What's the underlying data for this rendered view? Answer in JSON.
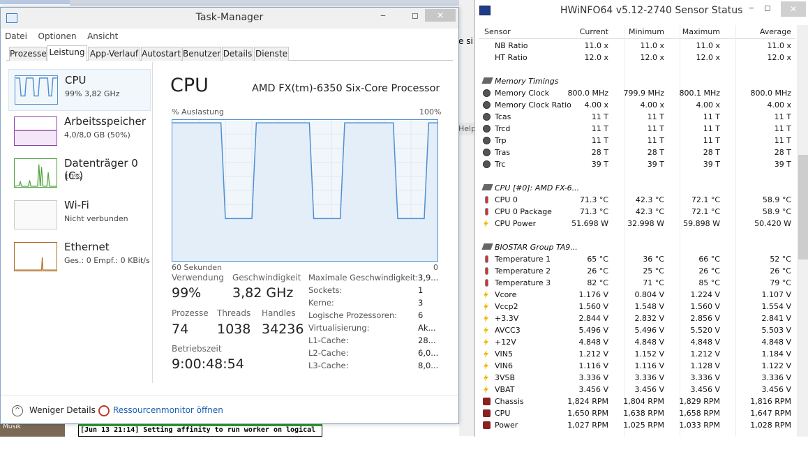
{
  "background": {
    "left_thumb_label": "Musik",
    "console_text": "[Jun 13 21:14] Setting affinity to run worker on logical",
    "edge_text": "e si",
    "edge_help": "Help"
  },
  "taskmanager": {
    "title": "Task-Manager",
    "window_buttons": [
      "‒",
      "◻",
      "✕"
    ],
    "menu": [
      "Datei",
      "Optionen",
      "Ansicht"
    ],
    "tabs": [
      "Prozesse",
      "Leistung",
      "App-Verlauf",
      "Autostart",
      "Benutzer",
      "Details",
      "Dienste"
    ],
    "active_tab": "Leistung",
    "sidebar": [
      {
        "name": "CPU",
        "sub": "99% 3,82 GHz"
      },
      {
        "name": "Arbeitsspeicher",
        "sub": "4,0/8,0 GB (50%)"
      },
      {
        "name": "Datenträger 0 (C:)",
        "sub": "10%"
      },
      {
        "name": "Wi-Fi",
        "sub": "Nicht verbunden"
      },
      {
        "name": "Ethernet",
        "sub": "Ges.: 0 Empf.: 0 KBit/s"
      }
    ],
    "cpu_title": "CPU",
    "cpu_model": "AMD FX(tm)-6350 Six-Core Processor",
    "util_label": "% Auslastung",
    "max_label": "100%",
    "time_label": "60 Sekunden",
    "zero_label": "0",
    "stats": {
      "util_label": "Verwendung",
      "util_value": "99%",
      "speed_label": "Geschwindigkeit",
      "speed_value": "3,82 GHz",
      "proc_label": "Prozesse",
      "proc_value": "74",
      "threads_label": "Threads",
      "threads_value": "1038",
      "handles_label": "Handles",
      "handles_value": "34236",
      "uptime_label": "Betriebszeit",
      "uptime_value": "9:00:48:54"
    },
    "details": [
      {
        "label": "Maximale Geschwindigkeit:",
        "value": "3,9..."
      },
      {
        "label": "Sockets:",
        "value": "1"
      },
      {
        "label": "Kerne:",
        "value": "3"
      },
      {
        "label": "Logische Prozessoren:",
        "value": "6"
      },
      {
        "label": "Virtualisierung:",
        "value": "Ak..."
      },
      {
        "label": "L1-Cache:",
        "value": "28..."
      },
      {
        "label": "L2-Cache:",
        "value": "6,0..."
      },
      {
        "label": "L3-Cache:",
        "value": "8,0..."
      }
    ],
    "fewer_details": "Weniger Details",
    "resource_monitor": "Ressourcenmonitor öffnen",
    "accent_color": "#4f8fd0",
    "cpu_graph_percent": [
      98,
      98,
      98,
      98,
      98,
      98,
      98,
      98,
      98,
      98,
      98,
      98,
      30,
      30,
      30,
      30,
      30,
      30,
      30,
      98,
      98,
      98,
      98,
      98,
      98,
      98,
      98,
      98,
      98,
      98,
      98,
      98,
      30,
      30,
      30,
      30,
      30,
      30,
      30,
      98,
      98,
      98,
      98,
      98,
      98,
      98,
      98,
      98,
      98,
      98,
      98,
      30,
      30,
      30,
      30,
      30,
      30,
      30,
      98,
      98,
      98
    ]
  },
  "hwinfo": {
    "title": "HWiNFO64 v5.12-2740 Sensor Status",
    "window_buttons": [
      "‒",
      "◻",
      "✕"
    ],
    "headers": [
      "Sensor",
      "Current",
      "Minimum",
      "Maximum",
      "Average"
    ],
    "rows": [
      {
        "icon": "none",
        "name": "NB Ratio",
        "cur": "11.0 x",
        "min": "11.0 x",
        "max": "11.0 x",
        "avg": "11.0 x"
      },
      {
        "icon": "none",
        "name": "HT Ratio",
        "cur": "12.0 x",
        "min": "12.0 x",
        "max": "12.0 x",
        "avg": "12.0 x"
      },
      {
        "icon": "blank",
        "name": "",
        "cur": "",
        "min": "",
        "max": "",
        "avg": ""
      },
      {
        "icon": "group",
        "name": "Memory Timings",
        "cur": "",
        "min": "",
        "max": "",
        "avg": ""
      },
      {
        "icon": "clock",
        "name": "Memory Clock",
        "cur": "800.0 MHz",
        "min": "799.9 MHz",
        "max": "800.1 MHz",
        "avg": "800.0 MHz"
      },
      {
        "icon": "clock",
        "name": "Memory Clock Ratio",
        "cur": "4.00 x",
        "min": "4.00 x",
        "max": "4.00 x",
        "avg": "4.00 x"
      },
      {
        "icon": "clock",
        "name": "Tcas",
        "cur": "11 T",
        "min": "11 T",
        "max": "11 T",
        "avg": "11 T"
      },
      {
        "icon": "clock",
        "name": "Trcd",
        "cur": "11 T",
        "min": "11 T",
        "max": "11 T",
        "avg": "11 T"
      },
      {
        "icon": "clock",
        "name": "Trp",
        "cur": "11 T",
        "min": "11 T",
        "max": "11 T",
        "avg": "11 T"
      },
      {
        "icon": "clock",
        "name": "Tras",
        "cur": "28 T",
        "min": "28 T",
        "max": "28 T",
        "avg": "28 T"
      },
      {
        "icon": "clock",
        "name": "Trc",
        "cur": "39 T",
        "min": "39 T",
        "max": "39 T",
        "avg": "39 T"
      },
      {
        "icon": "blank",
        "name": "",
        "cur": "",
        "min": "",
        "max": "",
        "avg": ""
      },
      {
        "icon": "group",
        "name": "CPU [#0]: AMD FX-6...",
        "cur": "",
        "min": "",
        "max": "",
        "avg": ""
      },
      {
        "icon": "thermo",
        "name": "CPU 0",
        "cur": "71.3 °C",
        "min": "42.3 °C",
        "max": "72.1 °C",
        "avg": "58.9 °C"
      },
      {
        "icon": "thermo",
        "name": "CPU 0 Package",
        "cur": "71.3 °C",
        "min": "42.3 °C",
        "max": "72.1 °C",
        "avg": "58.9 °C"
      },
      {
        "icon": "volt",
        "name": "CPU Power",
        "cur": "51.698 W",
        "min": "32.998 W",
        "max": "59.898 W",
        "avg": "50.420 W"
      },
      {
        "icon": "blank",
        "name": "",
        "cur": "",
        "min": "",
        "max": "",
        "avg": ""
      },
      {
        "icon": "group",
        "name": "BIOSTAR Group TA9...",
        "cur": "",
        "min": "",
        "max": "",
        "avg": ""
      },
      {
        "icon": "thermo",
        "name": "Temperature 1",
        "cur": "65 °C",
        "min": "36 °C",
        "max": "66 °C",
        "avg": "52 °C"
      },
      {
        "icon": "thermo",
        "name": "Temperature 2",
        "cur": "26 °C",
        "min": "25 °C",
        "max": "26 °C",
        "avg": "26 °C"
      },
      {
        "icon": "thermo",
        "name": "Temperature 3",
        "cur": "82 °C",
        "min": "71 °C",
        "max": "85 °C",
        "avg": "79 °C"
      },
      {
        "icon": "volt",
        "name": "Vcore",
        "cur": "1.176 V",
        "min": "0.804 V",
        "max": "1.224 V",
        "avg": "1.107 V"
      },
      {
        "icon": "volt",
        "name": "Vccp2",
        "cur": "1.560 V",
        "min": "1.548 V",
        "max": "1.560 V",
        "avg": "1.554 V"
      },
      {
        "icon": "volt",
        "name": "+3.3V",
        "cur": "2.844 V",
        "min": "2.832 V",
        "max": "2.856 V",
        "avg": "2.841 V"
      },
      {
        "icon": "volt",
        "name": "AVCC3",
        "cur": "5.496 V",
        "min": "5.496 V",
        "max": "5.520 V",
        "avg": "5.503 V"
      },
      {
        "icon": "volt",
        "name": "+12V",
        "cur": "4.848 V",
        "min": "4.848 V",
        "max": "4.848 V",
        "avg": "4.848 V"
      },
      {
        "icon": "volt",
        "name": "VIN5",
        "cur": "1.212 V",
        "min": "1.152 V",
        "max": "1.212 V",
        "avg": "1.184 V"
      },
      {
        "icon": "volt",
        "name": "VIN6",
        "cur": "1.116 V",
        "min": "1.116 V",
        "max": "1.128 V",
        "avg": "1.122 V"
      },
      {
        "icon": "volt",
        "name": "3VSB",
        "cur": "3.336 V",
        "min": "3.336 V",
        "max": "3.336 V",
        "avg": "3.336 V"
      },
      {
        "icon": "volt",
        "name": "VBAT",
        "cur": "3.456 V",
        "min": "3.456 V",
        "max": "3.456 V",
        "avg": "3.456 V"
      },
      {
        "icon": "fan",
        "name": "Chassis",
        "cur": "1,824 RPM",
        "min": "1,804 RPM",
        "max": "1,829 RPM",
        "avg": "1,816 RPM"
      },
      {
        "icon": "fan",
        "name": "CPU",
        "cur": "1,650 RPM",
        "min": "1,638 RPM",
        "max": "1,658 RPM",
        "avg": "1,647 RPM"
      },
      {
        "icon": "fan",
        "name": "Power",
        "cur": "1,027 RPM",
        "min": "1,025 RPM",
        "max": "1,033 RPM",
        "avg": "1,028 RPM"
      }
    ]
  }
}
